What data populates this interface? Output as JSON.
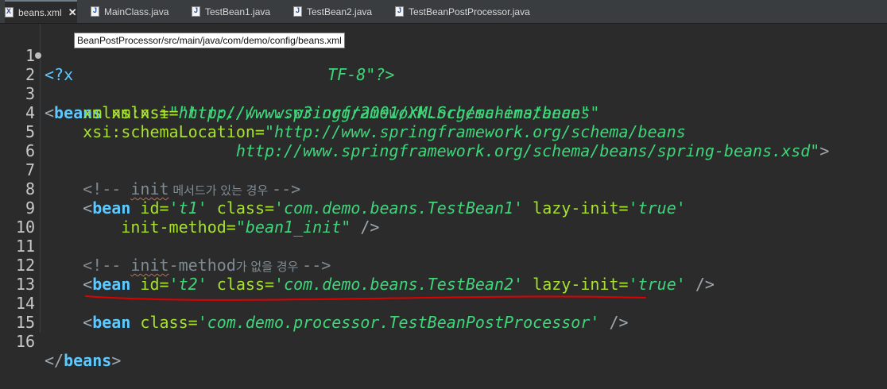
{
  "tabs": [
    {
      "label": "beans.xml",
      "icon": "xml-file-icon",
      "active": true,
      "closable": true
    },
    {
      "label": "MainClass.java",
      "icon": "java-file-icon",
      "active": false
    },
    {
      "label": "TestBean1.java",
      "icon": "java-file-icon",
      "active": false
    },
    {
      "label": "TestBean2.java",
      "icon": "java-file-icon",
      "active": false
    },
    {
      "label": "TestBeanPostProcessor.java",
      "icon": "java-file-icon",
      "active": false
    }
  ],
  "tooltip": "BeanPostProcessor/src/main/java/com/demo/config/beans.xml",
  "lines": {
    "n1": "1",
    "n2": "2",
    "n3": "3",
    "n4": "4",
    "n5": "5",
    "n6": "6",
    "n7": "7",
    "n8": "8",
    "n9": "9",
    "n10": "10",
    "n11": "11",
    "n12": "12",
    "n13": "13",
    "n14": "14",
    "n15": "15",
    "n16": "16"
  },
  "code": {
    "l1_open": "<?x",
    "l1_tail": "TF-8\"?>",
    "l2_lt": "<",
    "l2_tag": "beans",
    "l2_attr": " xmlns=",
    "l2_val": "\"http://www.springframework.org/schema/beans\"",
    "l3_attr": "    xmlns:xsi=",
    "l3_val": "\"http://www.w3.org/2001/XMLSchema-instance\"",
    "l4_attr": "    xsi:schemaLocation=",
    "l4_val": "\"http://www.springframework.org/schema/beans",
    "l5_val": "                    http://www.springframework.org/schema/beans/spring-beans.xsd\"",
    "l5_gt": ">",
    "l7_open": "    <!-- ",
    "l7_init": "init",
    "l7_kr": " 메서드가 있는 경우 ",
    "l7_close": "-->",
    "l8_lt": "    <",
    "l8_tag": "bean",
    "l8_a1": " id=",
    "l8_v1": "'t1'",
    "l8_a2": " class=",
    "l8_v2": "'com.demo.beans.TestBean1'",
    "l8_a3": " lazy-init=",
    "l8_v3": "'true'",
    "l9_attr": "        init-method=",
    "l9_val": "\"bean1_init\"",
    "l9_end": " />",
    "l11_open": "    <!-- ",
    "l11_init": "init",
    "l11_method": "-method",
    "l11_kr": "가 없을 경우 ",
    "l11_close": "-->",
    "l12_lt": "    <",
    "l12_tag": "bean",
    "l12_a1": " id=",
    "l12_v1": "'t2'",
    "l12_a2": " class=",
    "l12_v2": "'com.demo.beans.TestBean2'",
    "l12_a3": " lazy-init=",
    "l12_v3": "'true'",
    "l12_end": " />",
    "l14_lt": "    <",
    "l14_tag": "bean",
    "l14_a1": " class=",
    "l14_v1": "'com.demo.processor.TestBeanPostProcessor'",
    "l14_end": " />",
    "l16_lt": "</",
    "l16_tag": "beans",
    "l16_gt": ">"
  },
  "colors": {
    "background": "#2b2b2b",
    "tag": "#5ec8ff",
    "attribute": "#a6e22e",
    "value": "#3fd67a",
    "comment": "#7f8b92",
    "annotation": "#e00000"
  }
}
